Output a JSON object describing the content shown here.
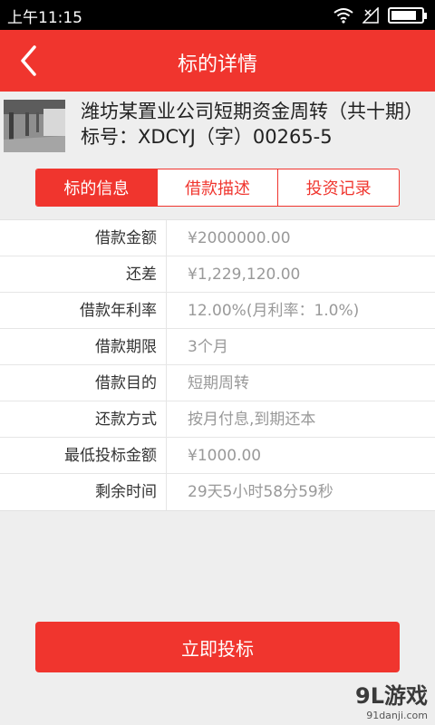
{
  "status": {
    "time": "上午11:15",
    "battery_level": 0.85
  },
  "header": {
    "title": "标的详情",
    "back_icon": "chevron-left-icon"
  },
  "loan": {
    "title": "潍坊某置业公司短期资金周转（共十期）标号：XDCYJ（字）00265-5",
    "thumbnail": "building-interior-image"
  },
  "tabs": [
    {
      "label": "标的信息",
      "active": true
    },
    {
      "label": "借款描述",
      "active": false
    },
    {
      "label": "投资记录",
      "active": false
    }
  ],
  "details": [
    {
      "label": "借款金额",
      "value": "¥2000000.00"
    },
    {
      "label": "还差",
      "value": "¥1,229,120.00"
    },
    {
      "label": "借款年利率",
      "value": "12.00%(月利率：1.0%)"
    },
    {
      "label": "借款期限",
      "value": "3个月"
    },
    {
      "label": "借款目的",
      "value": "短期周转"
    },
    {
      "label": "还款方式",
      "value": "按月付息,到期还本"
    },
    {
      "label": "最低投标金额",
      "value": "¥1000.00"
    },
    {
      "label": "剩余时间",
      "value": "29天5小时58分59秒"
    }
  ],
  "action": {
    "invest_label": "立即投标"
  },
  "watermark": {
    "logo": "9L游戏",
    "url": "91danji.com"
  },
  "colors": {
    "accent": "#f0352e",
    "background": "#eeeeee"
  }
}
